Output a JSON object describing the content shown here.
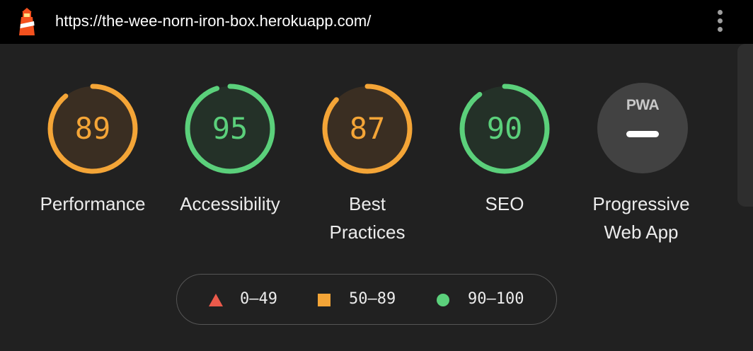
{
  "browser": {
    "url": "https://the-wee-norn-iron-box.herokuapp.com/",
    "logo_icon": "lighthouse-icon",
    "menu_icon": "more-vert-icon"
  },
  "categories": [
    {
      "label_line1": "Performance",
      "label_line2": "",
      "score": "89",
      "status": "average",
      "fraction": 0.89
    },
    {
      "label_line1": "Accessibility",
      "label_line2": "",
      "score": "95",
      "status": "pass",
      "fraction": 0.95
    },
    {
      "label_line1": "Best",
      "label_line2": "Practices",
      "score": "87",
      "status": "average",
      "fraction": 0.87
    },
    {
      "label_line1": "SEO",
      "label_line2": "",
      "score": "90",
      "status": "pass",
      "fraction": 0.9
    }
  ],
  "pwa": {
    "badge_text": "PWA",
    "label_line1": "Progressive",
    "label_line2": "Web App",
    "badge_icon": "pwa-badge-icon"
  },
  "legend": {
    "fail": {
      "range": "0–49",
      "shape": "triangle",
      "color": "#ff4e42"
    },
    "average": {
      "range": "50–89",
      "shape": "square",
      "color": "#ffa400"
    },
    "pass": {
      "range": "90–100",
      "shape": "circle",
      "color": "#0cce6b"
    }
  },
  "colors": {
    "average": "#f4a537",
    "average_bg": "#3a2e22",
    "pass": "#5bd07b",
    "pass_bg": "#243128",
    "fail": "#eb5a4b",
    "background": "#212121",
    "topbar": "#000000"
  }
}
